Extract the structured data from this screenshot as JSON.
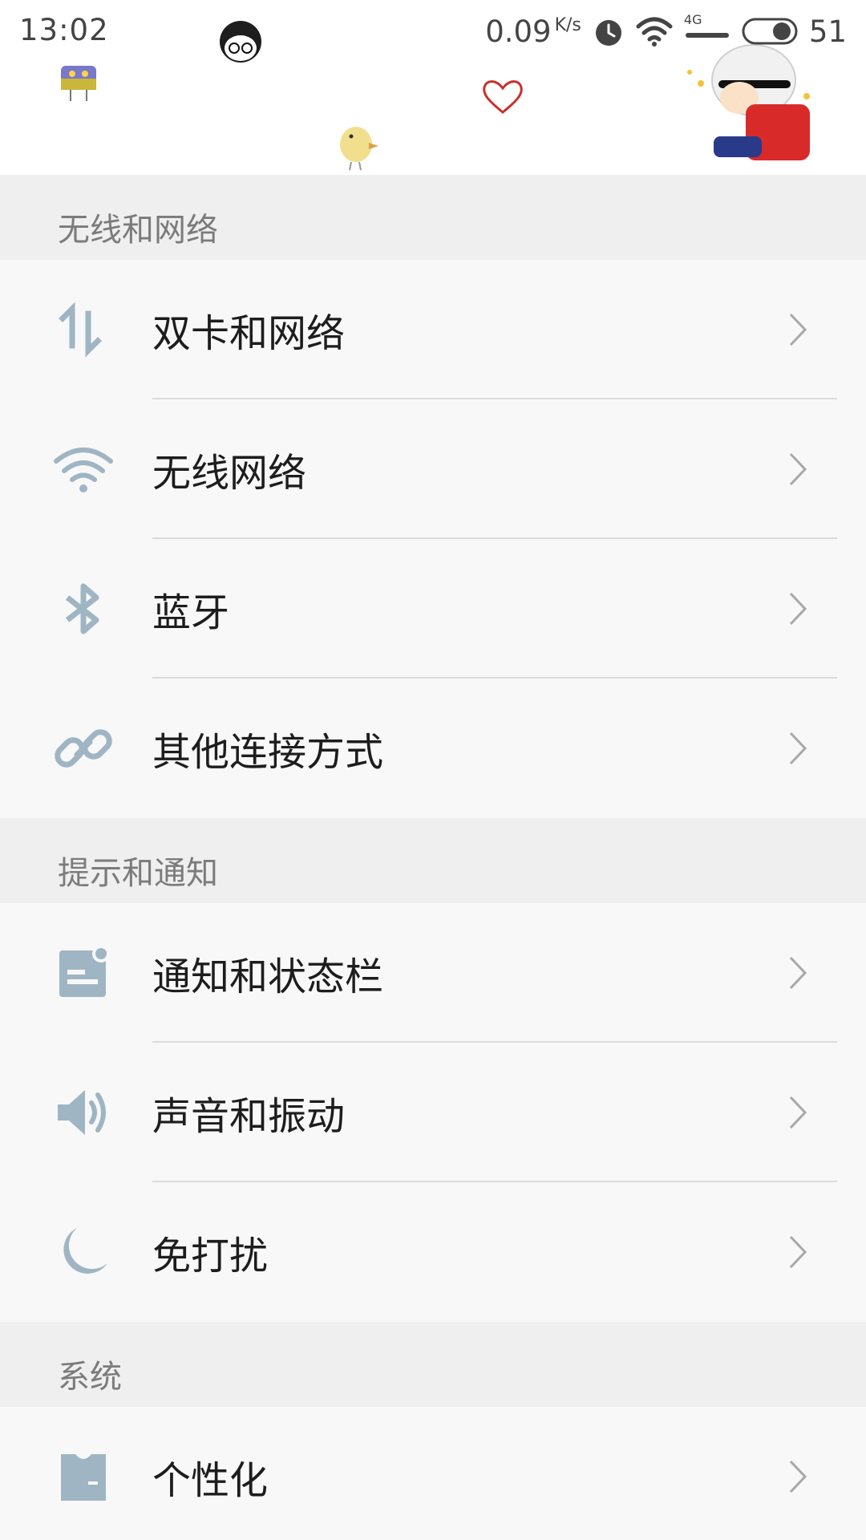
{
  "status_bar": {
    "time": "13:02",
    "speed_value": "0.09",
    "speed_unit": "K/s",
    "network_tag": "4G",
    "battery": "51"
  },
  "colors": {
    "icon_accent": "#9fb5c4",
    "section_bg": "#efefef",
    "row_bg": "#f8f8f8",
    "section_text": "#7b7b7b",
    "label_text": "#1d1d1d"
  },
  "sections": [
    {
      "title": "无线和网络",
      "items": [
        {
          "label": "双卡和网络",
          "icon": "dual-sim-data-icon"
        },
        {
          "label": "无线网络",
          "icon": "wifi-icon"
        },
        {
          "label": "蓝牙",
          "icon": "bluetooth-icon"
        },
        {
          "label": "其他连接方式",
          "icon": "link-icon"
        }
      ]
    },
    {
      "title": "提示和通知",
      "items": [
        {
          "label": "通知和状态栏",
          "icon": "notification-icon"
        },
        {
          "label": "声音和振动",
          "icon": "speaker-icon"
        },
        {
          "label": "免打扰",
          "icon": "moon-icon"
        }
      ]
    },
    {
      "title": "系统",
      "items": [
        {
          "label": "个性化",
          "icon": "tshirt-icon"
        }
      ]
    }
  ]
}
